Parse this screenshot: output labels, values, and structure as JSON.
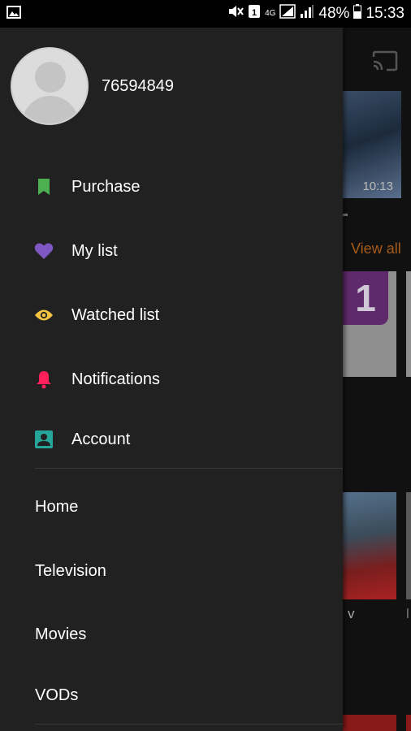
{
  "status_bar": {
    "battery": "48%",
    "time": "15:33",
    "network": "4G",
    "sim": "1"
  },
  "profile": {
    "username": "76594849"
  },
  "menu": [
    {
      "label": "Purchase",
      "icon": "bookmark-icon",
      "color": "#4caf50"
    },
    {
      "label": "My list",
      "icon": "heart-icon",
      "color": "#7e57c2"
    },
    {
      "label": "Watched list",
      "icon": "eye-icon",
      "color": "#f5c542"
    },
    {
      "label": "Notifications",
      "icon": "bell-icon",
      "color": "#ff1f5a"
    },
    {
      "label": "Account",
      "icon": "account-box-icon",
      "color": "#26a69a"
    }
  ],
  "nav": [
    {
      "label": "Home"
    },
    {
      "label": "Television"
    },
    {
      "label": "Movies"
    },
    {
      "label": "VODs"
    }
  ],
  "background": {
    "video_duration": "10:13",
    "view_all": "View all",
    "channel_logo": "1",
    "card_label": "v",
    "card_label_2": "l"
  },
  "colors": {
    "drawer_bg": "#212121",
    "view_all": "#a65b18"
  }
}
